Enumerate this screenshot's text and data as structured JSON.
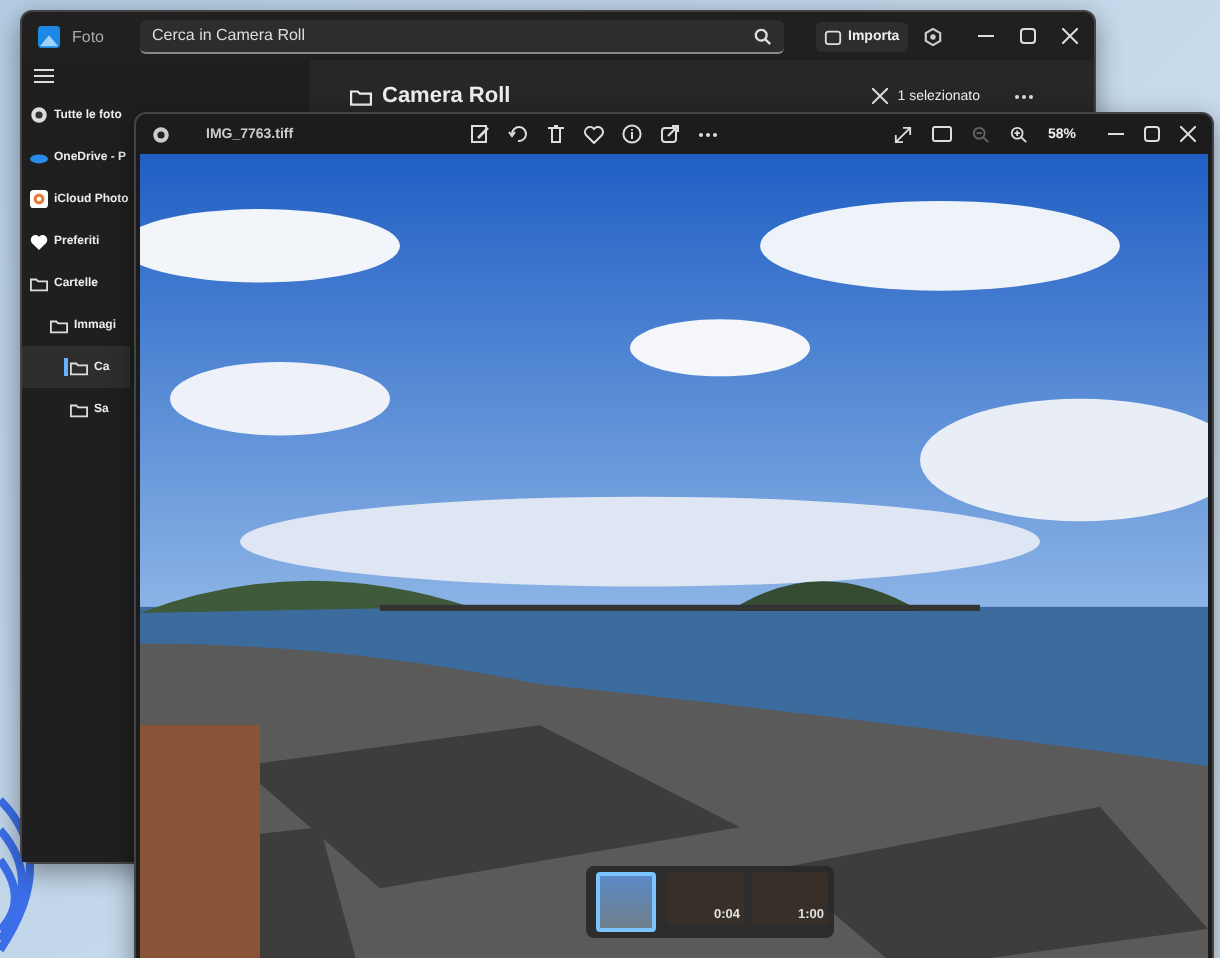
{
  "back_window": {
    "app_title": "Foto",
    "search": {
      "placeholder": "Cerca in Camera Roll"
    },
    "import_button": "Importa",
    "sidebar": {
      "items": [
        {
          "label": "Tutte le foto",
          "kind": "all",
          "selected": false
        },
        {
          "label": "OneDrive - P",
          "kind": "cloud",
          "selected": false
        },
        {
          "label": "iCloud Photo",
          "kind": "icloud",
          "selected": false
        },
        {
          "label": "Preferiti",
          "kind": "heart",
          "selected": false
        },
        {
          "label": "Cartelle",
          "kind": "folder",
          "selected": false,
          "children": [
            {
              "label": "Immagi",
              "kind": "folder",
              "selected": false,
              "children": [
                {
                  "label": "Ca",
                  "kind": "folder",
                  "selected": true
                },
                {
                  "label": "Sa",
                  "kind": "folder",
                  "selected": false
                }
              ]
            }
          ]
        }
      ]
    },
    "heading": "Camera Roll",
    "selection": "1 selezionato"
  },
  "viewer": {
    "file_name": "IMG_7763.tiff",
    "zoom": "58%",
    "filmstrip": [
      {
        "kind": "photo",
        "selected": true
      },
      {
        "kind": "video",
        "duration": "0:04",
        "selected": false
      },
      {
        "kind": "video",
        "duration": "1:00",
        "selected": false
      }
    ]
  }
}
